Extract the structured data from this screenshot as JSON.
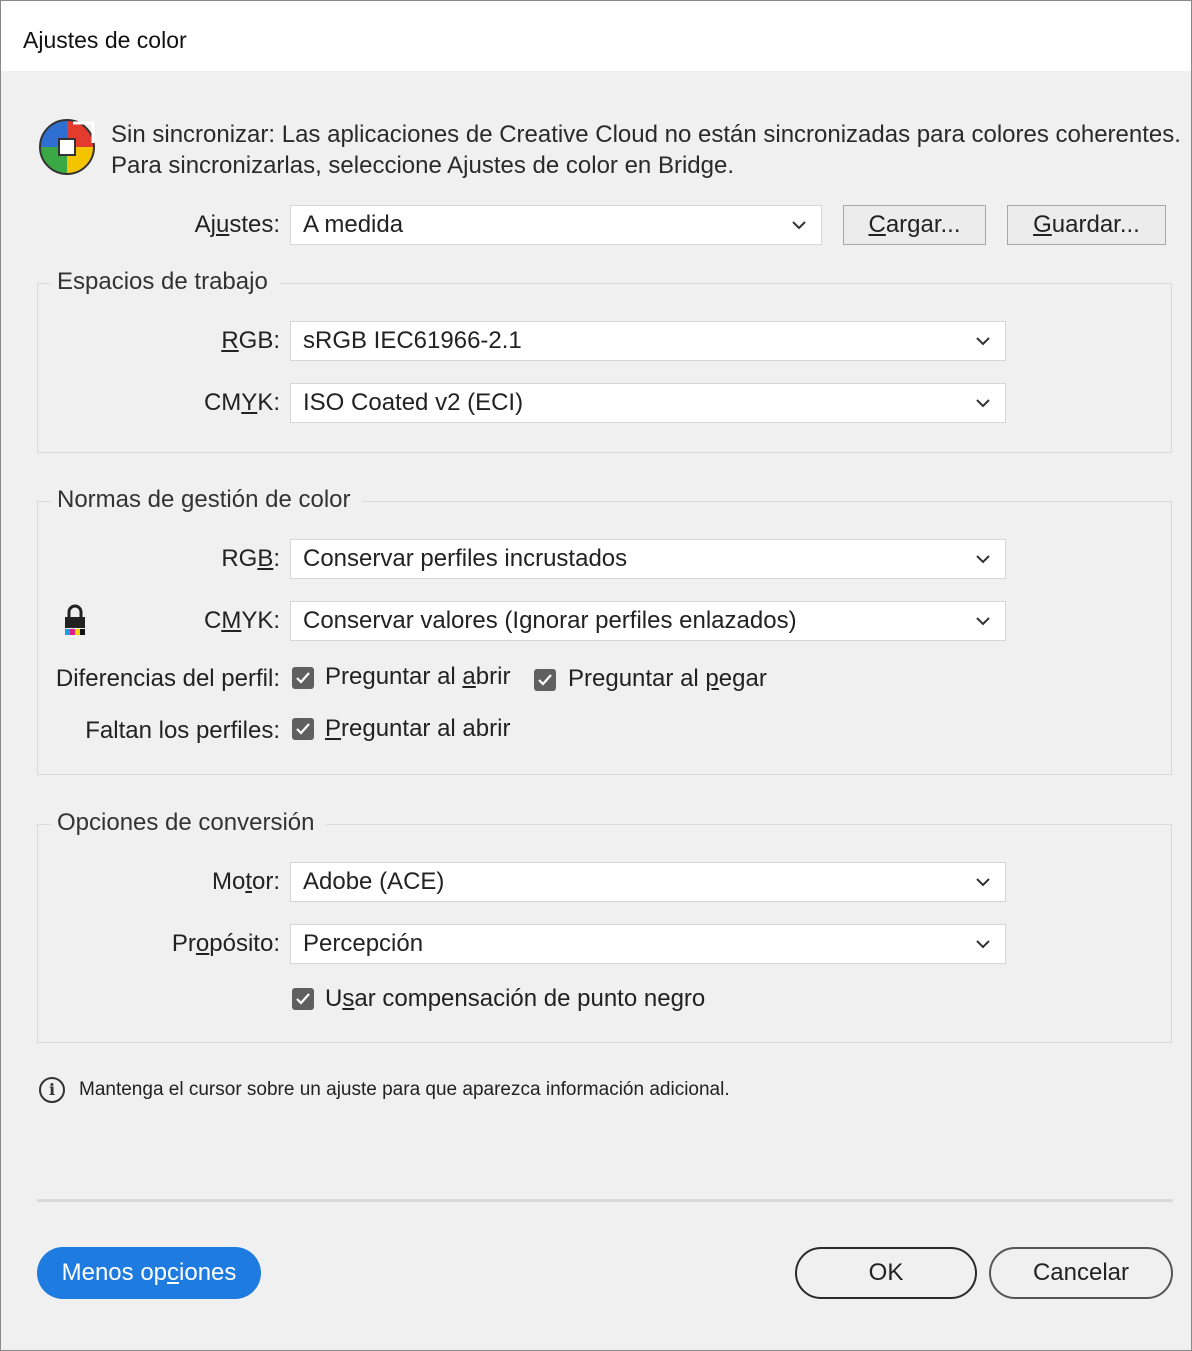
{
  "window": {
    "title": "Ajustes de color"
  },
  "sync": {
    "icon": "color-sync-icon",
    "line1": "Sin sincronizar: Las aplicaciones de Creative Cloud no están sincronizadas para colores coherentes.",
    "line2": "Para sincronizarlas, seleccione Ajustes de color en Bridge."
  },
  "settings": {
    "label_pre": "Aj",
    "label_u": "u",
    "label_post": "stes:",
    "value": "A medida",
    "load_u": "C",
    "load_rest": "argar...",
    "save_u": "G",
    "save_rest": "uardar..."
  },
  "working_spaces": {
    "legend": "Espacios de trabajo",
    "rgb_u": "R",
    "rgb_rest": "GB:",
    "rgb_value": "sRGB IEC61966-2.1",
    "cmyk_pre": "CM",
    "cmyk_u": "Y",
    "cmyk_post": "K:",
    "cmyk_value": "ISO Coated v2 (ECI)"
  },
  "policies": {
    "legend": "Normas de gestión de color",
    "rgb_pre": "RG",
    "rgb_u": "B",
    "rgb_post": ":",
    "rgb_value": "Conservar perfiles incrustados",
    "cmyk_pre": "C",
    "cmyk_u": "M",
    "cmyk_post": "YK:",
    "cmyk_value": "Conservar valores (Ignorar perfiles enlazados)",
    "lock_icon": "lock-icon",
    "mismatch_label": "Diferencias del perfil:",
    "mismatch_open_pre": "Preguntar al ",
    "mismatch_open_u": "a",
    "mismatch_open_post": "brir",
    "mismatch_open_checked": true,
    "mismatch_paste_pre": "Preguntar al ",
    "mismatch_paste_u": "p",
    "mismatch_paste_post": "egar",
    "mismatch_paste_checked": true,
    "missing_label": "Faltan los perfiles:",
    "missing_open_u": "P",
    "missing_open_post": "reguntar al abrir",
    "missing_open_checked": true
  },
  "conversion": {
    "legend": "Opciones de conversión",
    "engine_pre": "Mo",
    "engine_u": "t",
    "engine_post": "or:",
    "engine_value": "Adobe (ACE)",
    "intent_pre": "Pr",
    "intent_u": "o",
    "intent_post": "pósito:",
    "intent_value": "Percepción",
    "bpc_pre": "U",
    "bpc_u": "s",
    "bpc_post": "ar compensación de punto negro",
    "bpc_checked": true
  },
  "hint": {
    "icon": "info-icon",
    "text": "Mantenga el cursor sobre un ajuste para que aparezca información adicional."
  },
  "footer": {
    "fewer_pre": "Menos op",
    "fewer_u": "c",
    "fewer_post": "iones",
    "ok": "OK",
    "cancel": "Cancelar",
    "accent": "#1e7be0"
  }
}
